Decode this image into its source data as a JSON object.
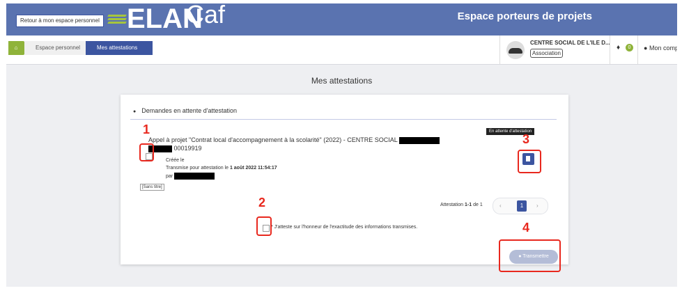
{
  "header": {
    "back_label": "Retour à mon espace personnel",
    "logo_main": "ELAN",
    "logo_sub": "Caf",
    "title": "Espace porteurs de projets",
    "bg_color": "#5a73b0"
  },
  "nav": {
    "home_icon": "home-icon",
    "breadcrumbs": [
      {
        "label": "Espace personnel"
      },
      {
        "label": "Mes attestations"
      }
    ],
    "org": {
      "name": "CENTRE SOCIAL DE L'ILE D...",
      "type": "Association"
    },
    "notifications": {
      "icon": "bell-icon",
      "count": "0"
    },
    "account_label": "Mon compte"
  },
  "page": {
    "title": "Mes attestations"
  },
  "card": {
    "section_title": "Demandes en attente d'attestation",
    "request": {
      "title": "Appel à projet \"Contrat local d'accompagnement à la scolarité\" (2022) - CENTRE SOCIAL",
      "number": "00019919",
      "status": "En attente d'attestation",
      "created_label": "Créée le",
      "transmitted_prefix": "Transmise pour attestation le ",
      "transmitted_date": "1 août 2022 11:54:17",
      "by_label": "par",
      "untitled": "[Sans titre]"
    },
    "pagination": {
      "prefix": "Attestation ",
      "range": "1-1",
      "suffix": " de 1",
      "current_page": "1",
      "prev": "‹",
      "next": "›"
    },
    "honor_text": "* J'atteste sur l'honneur de l'exactitude des informations transmises.",
    "submit_label": "Transmettre"
  },
  "annotations": {
    "n1": "1",
    "n2": "2",
    "n3": "3",
    "n4": "4",
    "color": "#e8281e"
  }
}
